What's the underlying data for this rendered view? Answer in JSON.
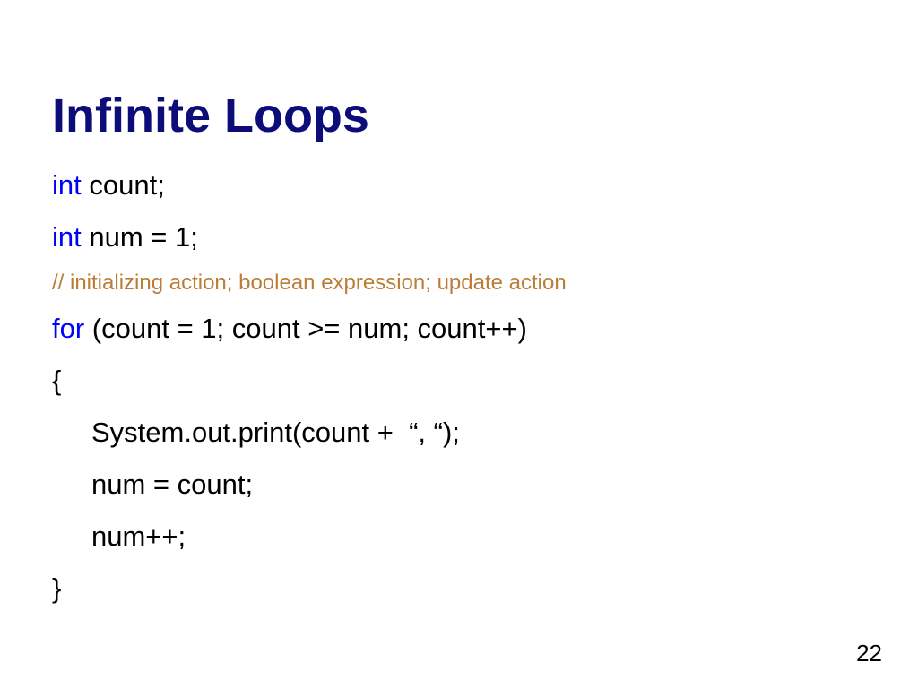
{
  "slide": {
    "title": "Infinite Loops",
    "page_number": "22",
    "background_color": "#ffffff",
    "title_color": "#0d0d7a",
    "keyword_color": "#0000ff",
    "comment_color": "#bb7d36",
    "text_color": "#000000"
  },
  "code": {
    "lines": [
      {
        "keyword": "int",
        "rest": " count;",
        "indent": false,
        "comment": false
      },
      {
        "keyword": "int",
        "rest": " num = 1;",
        "indent": false,
        "comment": false
      },
      {
        "keyword": "",
        "rest": "// initializing action; boolean expression; update action",
        "indent": false,
        "comment": true
      },
      {
        "keyword": "for",
        "rest": " (count = 1; count >= num; count++)",
        "indent": false,
        "comment": false
      },
      {
        "keyword": "",
        "rest": "{",
        "indent": false,
        "comment": false
      },
      {
        "keyword": "",
        "rest": "System.out.print(count +  “, “);",
        "indent": true,
        "comment": false
      },
      {
        "keyword": "",
        "rest": "num = count;",
        "indent": true,
        "comment": false
      },
      {
        "keyword": "",
        "rest": "num++;",
        "indent": true,
        "comment": false
      },
      {
        "keyword": "",
        "rest": "}",
        "indent": false,
        "comment": false
      }
    ]
  }
}
